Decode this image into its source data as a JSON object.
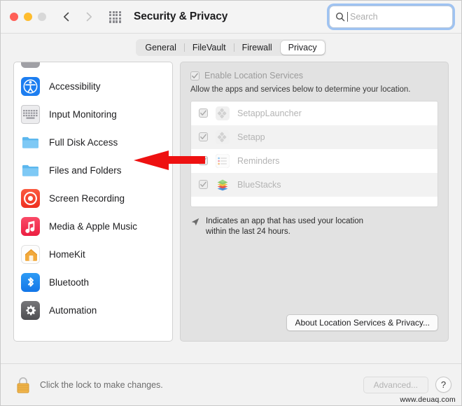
{
  "window": {
    "title": "Security & Privacy",
    "traffic_lights": [
      "close",
      "minimize",
      "zoom"
    ],
    "nav": {
      "back": "back-arrow",
      "forward": "forward-arrow",
      "grid": "show-all-grid"
    }
  },
  "search": {
    "placeholder": "Search",
    "value": "",
    "icon": "search-icon"
  },
  "tabs": [
    {
      "label": "General",
      "selected": false
    },
    {
      "label": "FileVault",
      "selected": false
    },
    {
      "label": "Firewall",
      "selected": false
    },
    {
      "label": "Privacy",
      "selected": true
    }
  ],
  "sidebar": {
    "items": [
      {
        "label": "",
        "icon": "partial-cut-off-icon",
        "color": "#a0a0a5"
      },
      {
        "label": "Accessibility",
        "icon": "accessibility-icon",
        "color": "#1d7ef0"
      },
      {
        "label": "Input Monitoring",
        "icon": "keyboard-icon",
        "color": "#e9e9ea"
      },
      {
        "label": "Full Disk Access",
        "icon": "folder-icon",
        "color": "#4aa8e8"
      },
      {
        "label": "Files and Folders",
        "icon": "folder-icon",
        "color": "#4aa8e8"
      },
      {
        "label": "Screen Recording",
        "icon": "screen-recording-icon",
        "color": "#f03e2f"
      },
      {
        "label": "Media & Apple Music",
        "icon": "music-icon",
        "color": "#f0334f"
      },
      {
        "label": "HomeKit",
        "icon": "homekit-icon",
        "color": "#ffffff"
      },
      {
        "label": "Bluetooth",
        "icon": "bluetooth-icon",
        "color": "#1d86f0"
      },
      {
        "label": "Automation",
        "icon": "gear-icon",
        "color": "#5d5d5f"
      }
    ]
  },
  "location_panel": {
    "enable_label": "Enable Location Services",
    "enable_checked": true,
    "enable_disabled": true,
    "description": "Allow the apps and services below to determine your location.",
    "apps": [
      {
        "name": "SetappLauncher",
        "checked": true,
        "icon": "setapp-icon"
      },
      {
        "name": "Setapp",
        "checked": true,
        "icon": "setapp-icon"
      },
      {
        "name": "Reminders",
        "checked": true,
        "icon": "reminders-icon"
      },
      {
        "name": "BlueStacks",
        "checked": true,
        "icon": "bluestacks-icon"
      }
    ],
    "note_icon": "location-arrow-icon",
    "note": "Indicates an app that has used your location within the last 24 hours.",
    "about_button": "About Location Services & Privacy..."
  },
  "footer": {
    "lock_icon": "closed-lock-icon",
    "lock_text": "Click the lock to make changes.",
    "advanced_button": "Advanced...",
    "advanced_disabled": true,
    "help_button": "?",
    "watermark": "www.deuaq.com"
  },
  "annotation": {
    "arrow_color": "#ee1111",
    "points_to": "Full Disk Access"
  }
}
